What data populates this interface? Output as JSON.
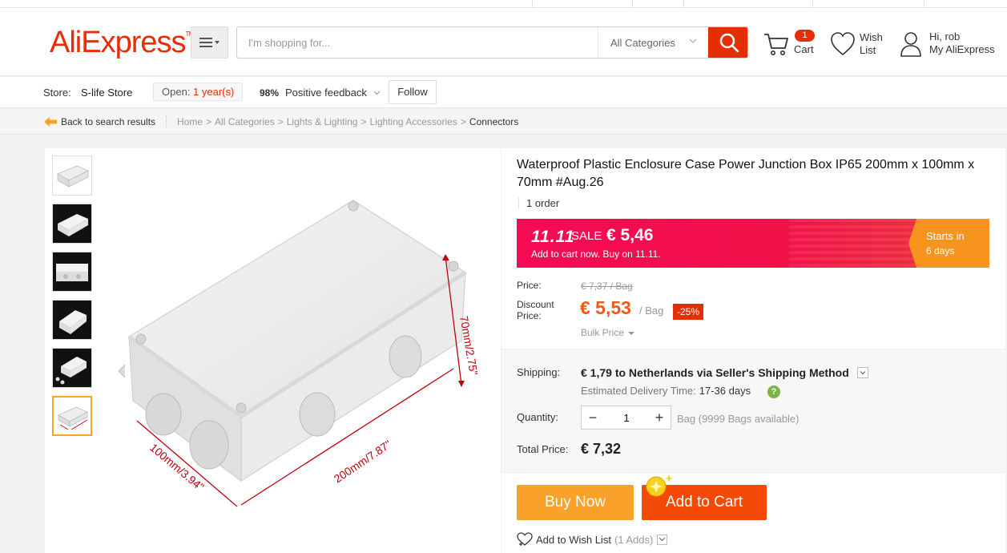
{
  "header": {
    "logo_text": "AliExpress",
    "logo_tm": "TM",
    "search_placeholder": "I'm shopping for...",
    "category": "All Categories",
    "cart_count": "1",
    "cart_label": "Cart",
    "wish_line1": "Wish",
    "wish_line2": "List",
    "account_line1": "Hi, rob",
    "account_line2": "My AliExpress",
    "brand_color": "#e62e04"
  },
  "store": {
    "label": "Store:",
    "name": "S-life Store",
    "open_prefix": "Open:",
    "open_years": "1 year(s)",
    "feedback_pct": "98%",
    "feedback_label": "Positive feedback",
    "follow_label": "Follow"
  },
  "breadcrumb": {
    "back_label": "Back to search results",
    "items": [
      "Home",
      "All Categories",
      "Lights & Lighting",
      "Lighting Accessories"
    ],
    "current": "Connectors"
  },
  "gallery": {
    "thumbnails": [
      "light",
      "dark",
      "dark",
      "dark",
      "dark",
      "light-active"
    ],
    "dimension_height": "70mm/2.75\"",
    "dimension_length": "200mm/7.87\"",
    "dimension_width": "100mm/3.94\""
  },
  "product": {
    "title": "Waterproof Plastic Enclosure Case Power Junction Box IP65 200mm x 100mm x 70mm #Aug.26",
    "orders": "1 order",
    "sale": {
      "badge": "11.11",
      "label": "SALE",
      "price": "€ 5,46",
      "sub": "Add to cart now. Buy on 11.11.",
      "starts_label": "Starts in",
      "starts_value": "6 days"
    },
    "price_label": "Price:",
    "original_price": "€ 7,37 / Bag",
    "discount_label_1": "Discount",
    "discount_label_2": "Price:",
    "discount_price": "€ 5,53",
    "per_unit": "/ Bag",
    "discount_pct": "-25%",
    "bulk_price": "Bulk Price"
  },
  "shipping": {
    "label": "Shipping:",
    "value": "€ 1,79 to Netherlands via Seller's Shipping Method",
    "est_label": "Estimated Delivery Time:",
    "est_days": "17-36 days",
    "help": "?"
  },
  "quantity": {
    "label": "Quantity:",
    "value": "1",
    "minus": "−",
    "plus": "+",
    "available": "Bag (9999 Bags available)"
  },
  "total": {
    "label": "Total Price:",
    "value": "€ 7,32"
  },
  "actions": {
    "buy_now": "Buy Now",
    "add_to_cart": "Add to Cart",
    "wishlist": "Add to Wish List",
    "wishlist_adds": "(1 Adds)"
  }
}
